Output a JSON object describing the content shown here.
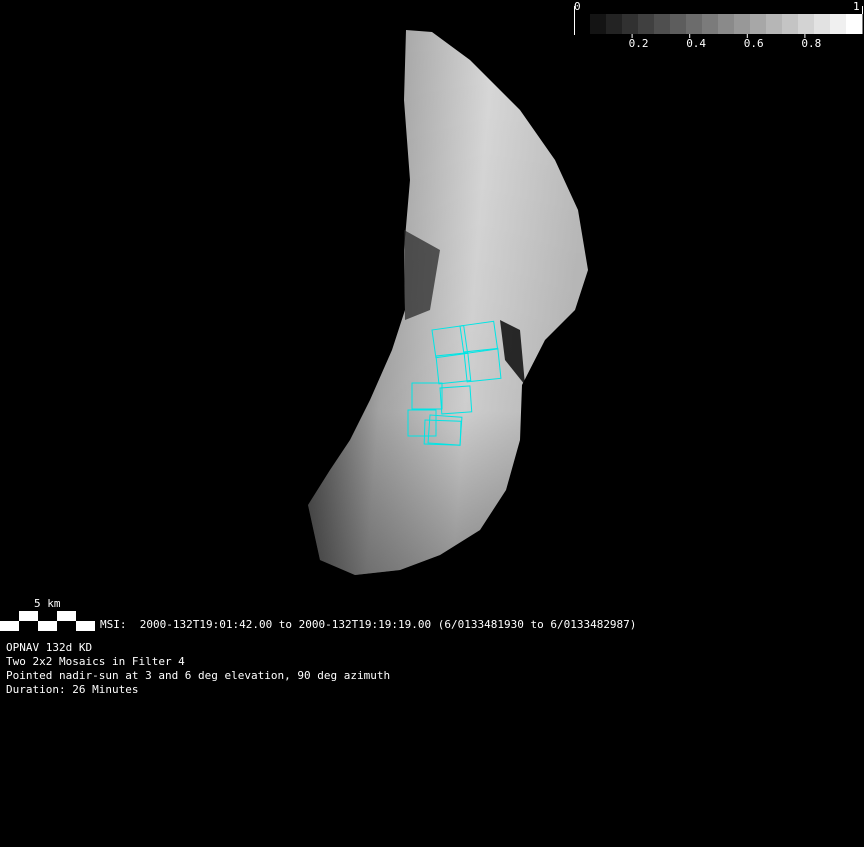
{
  "colorbar": {
    "min_label": "0",
    "max_label": "1",
    "ticks": [
      "0.2",
      "0.4",
      "0.6",
      "0.8"
    ],
    "tick_values": [
      0.2,
      0.4,
      0.6,
      0.8
    ],
    "levels": 17
  },
  "scale_bar": {
    "label": "5 km",
    "segments": 5
  },
  "msi_line": "MSI:  2000-132T19:01:42.00 to 2000-132T19:19:19.00 (6/0133481930 to 6/0133482987)",
  "info_lines": [
    "OPNAV 132d KD",
    "Two 2x2 Mosaics in Filter 4",
    "Pointed nadir-sun at 3 and 6 deg elevation, 90 deg azimuth",
    "Duration: 26 Minutes"
  ],
  "colors": {
    "footprint": "#00e5e5",
    "background": "#000000"
  }
}
